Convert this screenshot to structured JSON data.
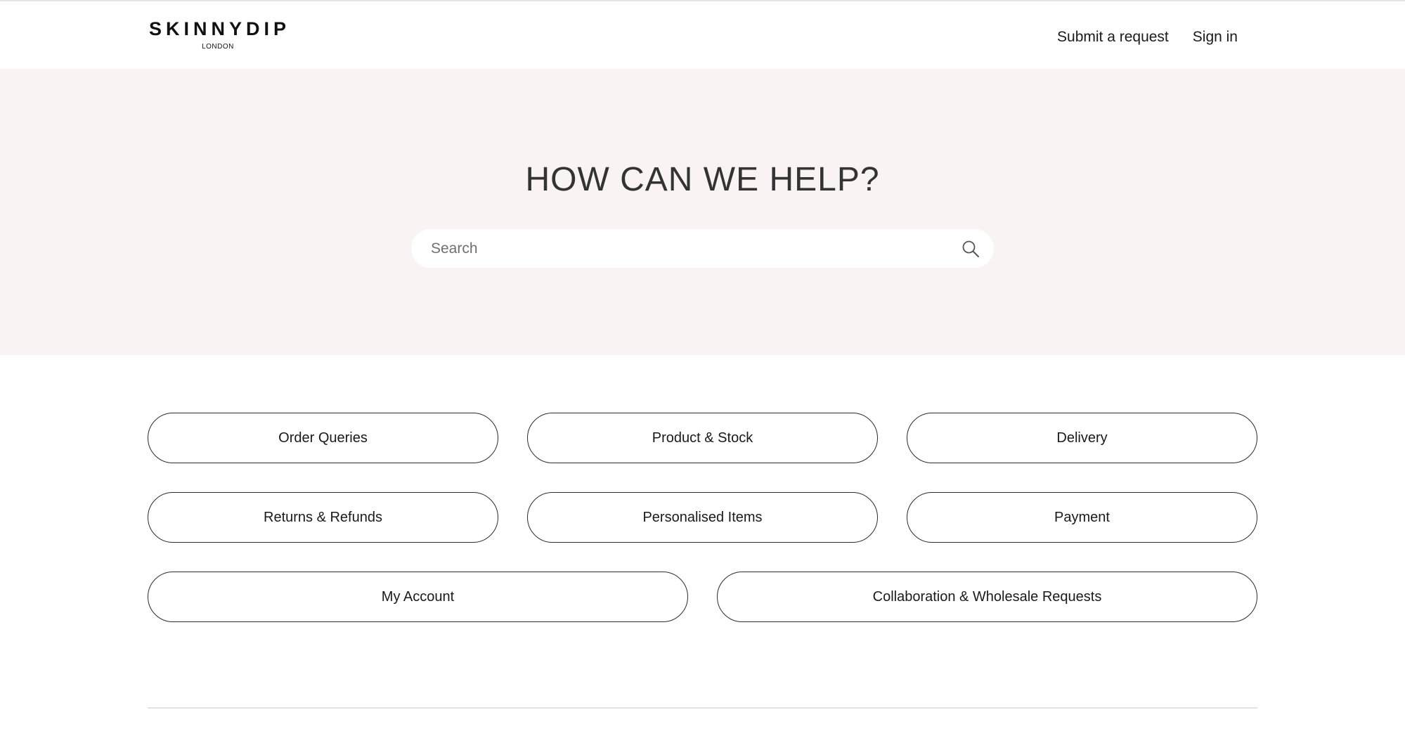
{
  "header": {
    "logo_main": "SKINNYDIP",
    "logo_sub": "LONDON",
    "nav": {
      "submit_request": "Submit a request",
      "sign_in": "Sign in"
    }
  },
  "hero": {
    "title": "HOW CAN WE HELP?",
    "search_placeholder": "Search",
    "search_value": ""
  },
  "categories": [
    "Order Queries",
    "Product & Stock",
    "Delivery",
    "Returns & Refunds",
    "Personalised Items",
    "Payment",
    "My Account",
    "Collaboration & Wholesale Requests"
  ],
  "colors": {
    "hero_background": "#f9f3f3",
    "button_border": "#2b2b2b",
    "text": "#1a1a1a"
  },
  "icons": {
    "search": "search-icon"
  }
}
